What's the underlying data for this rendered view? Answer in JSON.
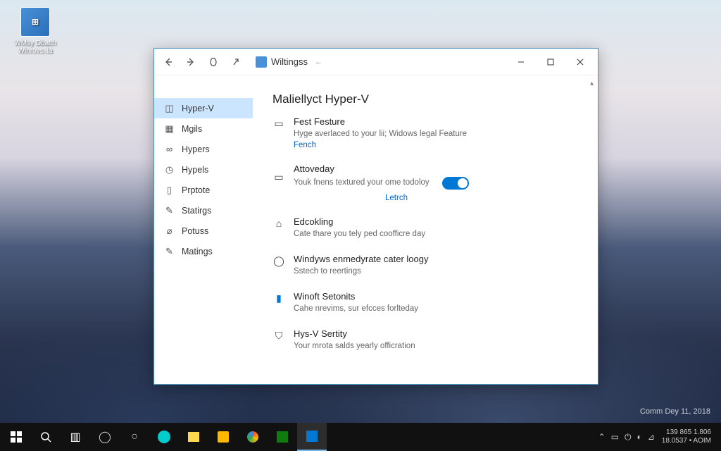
{
  "desktop_icon": {
    "label": "WMsy Dbach\nWinrovs.ila"
  },
  "watermark": "Comm Dey 11, 2018",
  "window": {
    "title": "Wiltingss",
    "controls": {
      "min": "min",
      "max": "max",
      "close": "close"
    }
  },
  "sidebar": {
    "items": [
      {
        "icon": "cube",
        "label": "Hyper-V",
        "active": true
      },
      {
        "icon": "grid",
        "label": "Mgils"
      },
      {
        "icon": "link",
        "label": "Hypers"
      },
      {
        "icon": "clock",
        "label": "Hypels"
      },
      {
        "icon": "doc",
        "label": "Prptote"
      },
      {
        "icon": "pen",
        "label": "Statirgs"
      },
      {
        "icon": "link2",
        "label": "Potuss"
      },
      {
        "icon": "pen2",
        "label": "Matings"
      }
    ]
  },
  "page": {
    "title": "Maliellyct Hyper-V",
    "sections": [
      {
        "icon": "feature",
        "title": "Fest Festure",
        "desc": "Hyge averlaced to your lii; Widows legal Feature",
        "link": "Fench"
      },
      {
        "icon": "monitor",
        "title": "Attoveday",
        "desc": "Youk fnens textured your ome todoloy",
        "toggle": true,
        "sublink": "Letrch"
      },
      {
        "icon": "bag",
        "title": "Edcokling",
        "desc": "Cate thare you tely ped coofficre day"
      },
      {
        "icon": "shield",
        "title": "Windyws enmedyrate cater loogy",
        "desc": "Sstech to reertings"
      },
      {
        "icon": "server",
        "title": "Winoft Setonits",
        "desc": "Cahe nrevims, sur efcces forlteday"
      },
      {
        "icon": "lock",
        "title": "Hys-V Sertity",
        "desc": "Your mrota salds yearly officration"
      }
    ]
  },
  "taskbar": {
    "tray": {
      "line1": "139 865   1.806",
      "line2": "18.0537 • AOIM"
    }
  }
}
